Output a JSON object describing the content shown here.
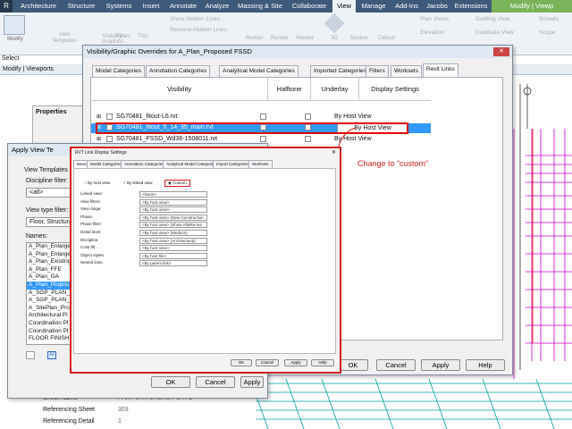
{
  "ribbon": {
    "tabs": [
      "Architecture",
      "Structure",
      "Systems",
      "Insert",
      "Annotate",
      "Analyze",
      "Massing & Site",
      "Collaborate",
      "View",
      "Manage",
      "Add-Ins",
      "Jacobs",
      "Extensions",
      "Modify | Viewp"
    ],
    "show_hidden_lines": "Show Hidden Lines",
    "remove_hidden_lines": "Remove Hidden Lines",
    "plan_views": "Plan Views",
    "elevation": "Elevation",
    "drafting_view": "Drafting View",
    "duplicate_view": "Duplicate View",
    "schedules": "Schedu",
    "scope": "Scope",
    "modify": "Modify",
    "view": "View",
    "templates": "Templates",
    "visibility_graphics": "Visibility/ Graphics",
    "filters": "Filters",
    "thin": "Thin",
    "render": [
      "Render",
      "Render",
      "Render"
    ],
    "three_d": "3D",
    "section": "Section",
    "callout": "Callout",
    "select": "Select",
    "modify_viewports": "Modify | Viewports"
  },
  "properties": {
    "title": "Properties"
  },
  "vg_dialog": {
    "title": "Visibility/Graphic Overrides for A_Plan_Proposed FSSD",
    "tabs": [
      "Model Categories",
      "Annotation Categories",
      "Analytical Model Categories",
      "Imported Categories",
      "Filters",
      "Worksets",
      "Revit Links"
    ],
    "columns": [
      "Visibility",
      "Halftone",
      "Underlay",
      "Display Settings"
    ],
    "rows": [
      {
        "name": "SG70481_fitout-L6.rvt",
        "display": "By Host View"
      },
      {
        "name": "SG70481_fitout_5_14_35_main.rvt",
        "display": "By Host View"
      },
      {
        "name": "SG70481_FSSD_Wd36-1508011.rvt",
        "display": "By Host View"
      }
    ],
    "buttons": {
      "ok": "OK",
      "cancel": "Cancel",
      "apply": "Apply",
      "help": "Help"
    }
  },
  "annotation": {
    "text": "Change to “custom”"
  },
  "avt_dialog": {
    "title": "Apply View Te",
    "view_templates": "View Templates",
    "discipline_filter": "Discipline filter:",
    "discipline_value": "<all>",
    "view_type_filter": "View type filter:",
    "view_type_value": "Floor, Structura",
    "names_label": "Names:",
    "names": [
      "A_Plan_Enlarge",
      "A_Plan_Enlarge",
      "A_Plan_Existing",
      "A_Plan_FFE",
      "A_Plan_GA",
      "A_Plan_Propos",
      "A_SGP_PLAN_E",
      "A_SGP_PLAN_L",
      "A_SitePlan_Pro",
      "Architectural Pl",
      "Coordination Pl",
      "Coordination Pl",
      "FLOOR FINISHI"
    ],
    "selected_index": 5,
    "buttons": {
      "ok": "OK",
      "cancel": "Cancel",
      "apply": "Apply"
    }
  },
  "rlds": {
    "title": "RVT Link Display Settings",
    "tabs": [
      "Basics",
      "Model Categories",
      "Annotation Categories",
      "Analytical Model Categories",
      "Import Categories",
      "Worksets"
    ],
    "radio": [
      "By host view",
      "By linked view",
      "Custom"
    ],
    "fields": [
      {
        "label": "Linked view:",
        "value": "<None>"
      },
      {
        "label": "View filters:",
        "value": "<By host view>"
      },
      {
        "label": "View range:",
        "value": "<By host view>"
      },
      {
        "label": "Phase:",
        "value": "<By host view> (New Construction"
      },
      {
        "label": "Phase filter:",
        "value": "<By host view> (Show All&Re-sut"
      },
      {
        "label": "Detail level:",
        "value": "<By host view> (Medium)"
      },
      {
        "label": "Discipline:",
        "value": "<By host view> (Architectural)"
      },
      {
        "label": "Color fill:",
        "value": "<By host view>"
      },
      {
        "label": "Object styles:",
        "value": "<By host file>"
      },
      {
        "label": "Nested links:",
        "value": "<By parent link>"
      }
    ],
    "buttons": {
      "ok": "OK",
      "cancel": "Cancel",
      "apply": "Apply",
      "help": "Help"
    }
  },
  "props_bottom": {
    "sheet_name_label": "Sheet Name",
    "sheet_name_value": "PART 5TH STOREY LAYO",
    "ref_sheet_label": "Referencing Sheet",
    "ref_sheet_value": "303",
    "ref_detail_label": "Referencing Detail",
    "ref_detail_value": "1"
  },
  "colors": {
    "ribbon_tabs": "#3e5a7a",
    "ribbon_body": "#eef2f6",
    "highlight_red": "#e00000",
    "selection_blue": "#3399ff",
    "annotation_red": "#d42020"
  }
}
